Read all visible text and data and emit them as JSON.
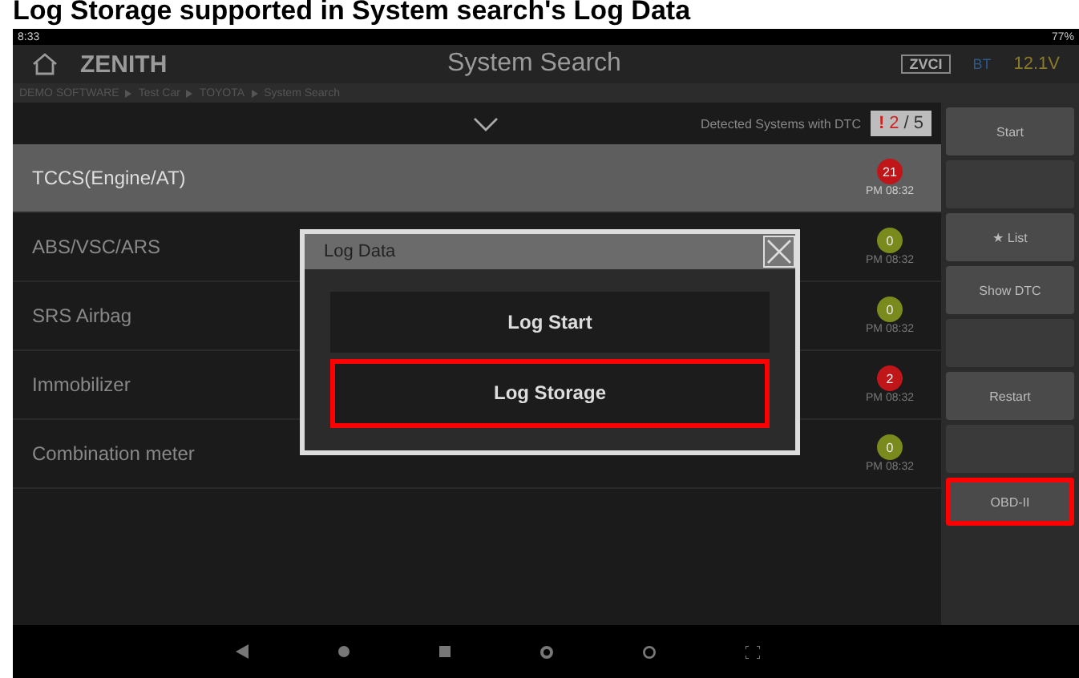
{
  "caption": "Log Storage supported in System search's Log Data",
  "status_bar": {
    "time": "8:33",
    "battery": "77%"
  },
  "header": {
    "logo": "ZENITH",
    "title": "System Search",
    "device": "ZVCI",
    "bt": "BT",
    "voltage": "12.1V"
  },
  "breadcrumb": [
    "DEMO SOFTWARE",
    "Test Car",
    "TOYOTA",
    "System Search"
  ],
  "summary": {
    "label": "Detected Systems with DTC",
    "alert": "!",
    "count": "2",
    "total": "/ 5"
  },
  "systems": [
    {
      "name": "TCCS(Engine/AT)",
      "dtc": "21",
      "time": "PM 08:32",
      "color": "#c0161a",
      "selected": true
    },
    {
      "name": "ABS/VSC/ARS",
      "dtc": "0",
      "time": "PM 08:32",
      "color": "#7a8a1c",
      "selected": false
    },
    {
      "name": "SRS Airbag",
      "dtc": "0",
      "time": "PM 08:32",
      "color": "#7a8a1c",
      "selected": false
    },
    {
      "name": "Immobilizer",
      "dtc": "2",
      "time": "PM 08:32",
      "color": "#c0161a",
      "selected": false
    },
    {
      "name": "Combination meter",
      "dtc": "0",
      "time": "PM 08:32",
      "color": "#7a8a1c",
      "selected": false
    }
  ],
  "sidebar": [
    {
      "kind": "button",
      "label": "Start",
      "highlighted": false
    },
    {
      "kind": "empty"
    },
    {
      "kind": "button",
      "label": "★ List",
      "highlighted": false
    },
    {
      "kind": "button",
      "label": "Show DTC",
      "highlighted": false
    },
    {
      "kind": "empty"
    },
    {
      "kind": "button",
      "label": "Restart",
      "highlighted": false
    },
    {
      "kind": "empty"
    },
    {
      "kind": "button",
      "label": "OBD-II",
      "highlighted": true
    }
  ],
  "dialog": {
    "title": "Log Data",
    "buttons": [
      {
        "label": "Log Start",
        "highlighted": false
      },
      {
        "label": "Log Storage",
        "highlighted": true
      }
    ]
  }
}
